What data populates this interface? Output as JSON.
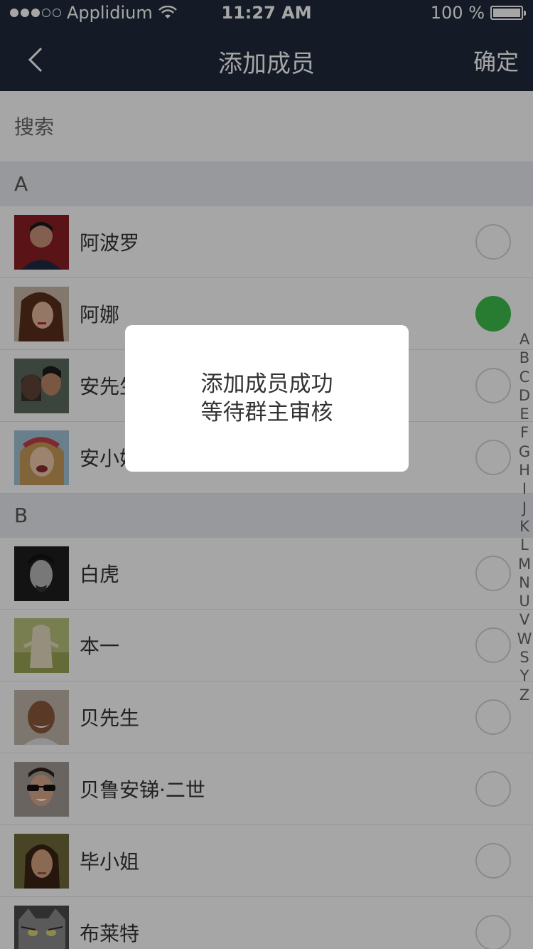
{
  "status_bar": {
    "carrier": "Applidium",
    "time": "11:27 AM",
    "battery": "100 %"
  },
  "nav": {
    "title": "添加成员",
    "confirm": "确定"
  },
  "search": {
    "placeholder": "搜索"
  },
  "sections": [
    {
      "letter": "A",
      "contacts": [
        {
          "name": "阿波罗",
          "selected": false
        },
        {
          "name": "阿娜",
          "selected": true
        },
        {
          "name": "安先生",
          "selected": false
        },
        {
          "name": "安小姐",
          "selected": false
        }
      ]
    },
    {
      "letter": "B",
      "contacts": [
        {
          "name": "白虎",
          "selected": false
        },
        {
          "name": "本一",
          "selected": false
        },
        {
          "name": "贝先生",
          "selected": false
        },
        {
          "name": "贝鲁安锑·二世",
          "selected": false
        },
        {
          "name": "毕小姐",
          "selected": false
        },
        {
          "name": "布莱特",
          "selected": false
        }
      ]
    }
  ],
  "index_letters": [
    "A",
    "B",
    "C",
    "D",
    "E",
    "F",
    "G",
    "H",
    "I",
    "J",
    "K",
    "L",
    "M",
    "N",
    "U",
    "V",
    "W",
    "S",
    "Y",
    "Z"
  ],
  "dialog": {
    "line1": "添加成员成功",
    "line2": "等待群主审核"
  },
  "colors": {
    "nav_bg": "#1f2a3c",
    "check_green": "#3cbf4e",
    "section_bg": "#e8ebf0"
  }
}
